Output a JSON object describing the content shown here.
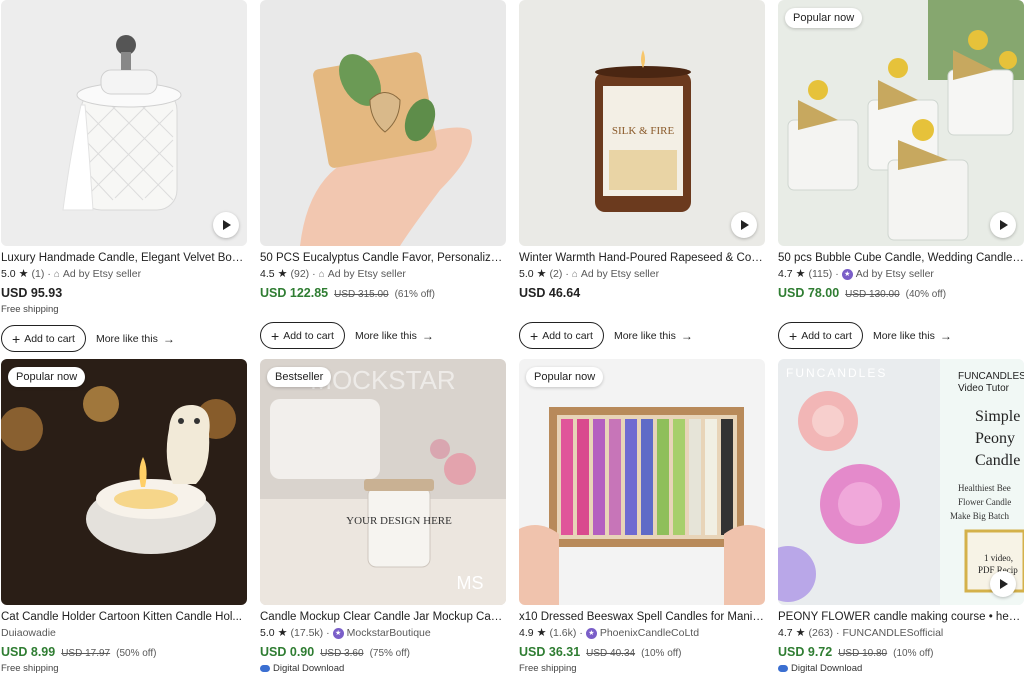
{
  "listings": [
    {
      "title": "Luxury Handmade Candle, Elegant Velvet Box,...",
      "rating": "5.0",
      "reviews": "(1)",
      "ad": "Ad by Etsy seller",
      "price": "USD 95.93",
      "shipping": "Free shipping",
      "add_to_cart": "Add to cart",
      "more_like": "More like this"
    },
    {
      "title": "50 PCS Eucalyptus Candle Favor, Personalized...",
      "rating": "4.5",
      "reviews": "(92)",
      "ad": "Ad by Etsy seller",
      "price": "USD 122.85",
      "original_price": "USD 315.00",
      "discount": "(61% off)",
      "add_to_cart": "Add to cart",
      "more_like": "More like this"
    },
    {
      "title": "Winter Warmth Hand-Poured Rapeseed & Coc...",
      "rating": "5.0",
      "reviews": "(2)",
      "ad": "Ad by Etsy seller",
      "price": "USD 46.64",
      "add_to_cart": "Add to cart",
      "more_like": "More like this",
      "image_text": {
        "brand": "SILK & FIRE"
      }
    },
    {
      "badge": "Popular now",
      "title": "50 pcs Bubble Cube Candle, Wedding Candle ...",
      "rating": "4.7",
      "reviews": "(115)",
      "ad": "Ad by Etsy seller",
      "price": "USD 78.00",
      "original_price": "USD 130.00",
      "discount": "(40% off)",
      "add_to_cart": "Add to cart",
      "more_like": "More like this"
    },
    {
      "badge": "Popular now",
      "title": "Cat Candle Holder Cartoon Kitten Candle Hol...",
      "shop": "Duiaowadie",
      "price": "USD 8.99",
      "original_price": "USD 17.97",
      "discount": "(50% off)",
      "shipping": "Free shipping"
    },
    {
      "badge": "Bestseller",
      "title": "Candle Mockup Clear Candle Jar Mockup Can...",
      "rating": "5.0",
      "reviews": "(17.5k)",
      "shop": "MockstarBoutique",
      "price": "USD 0.90",
      "original_price": "USD 3.60",
      "discount": "(75% off)",
      "digital": "Digital Download",
      "image_text": {
        "watermark": "MOCKSTAR",
        "jar": "YOUR DESIGN HERE",
        "logo": "MS"
      }
    },
    {
      "badge": "Popular now",
      "title": "x10 Dressed Beeswax Spell Candles for Manife...",
      "rating": "4.9",
      "reviews": "(1.6k)",
      "shop": "PhoenixCandleCoLtd",
      "price": "USD 36.31",
      "original_price": "USD 40.34",
      "discount": "(10% off)",
      "shipping": "Free shipping"
    },
    {
      "title": "PEONY FLOWER candle making course • healt...",
      "rating": "4.7",
      "reviews": "(263)",
      "shop": "FUNCANDLESofficial",
      "price": "USD 9.72",
      "original_price": "USD 10.80",
      "discount": "(10% off)",
      "digital": "Digital Download",
      "image_text": {
        "brand": "FUNCANDLES",
        "panel_title": "FUNCANDLES",
        "panel_sub": "Video Tutor",
        "line1": "Simple",
        "line2": "Peony",
        "line3": "Candle",
        "tag1": "Healthiest Bee",
        "tag2": "Flower Candle",
        "tag3": "Make Big Batch",
        "frame1": "1 video,",
        "frame2": "PDF Recip"
      }
    }
  ],
  "colors": {
    "sale_green": "#2f7d32",
    "text": "#222222",
    "muted": "#595959",
    "star_seller": "#7a5ec8"
  },
  "icons": {
    "star": "star-icon",
    "play": "play-icon",
    "plus": "plus-icon",
    "arrow": "arrow-right-icon",
    "shop": "shop-icon",
    "cloud": "cloud-download-icon"
  }
}
